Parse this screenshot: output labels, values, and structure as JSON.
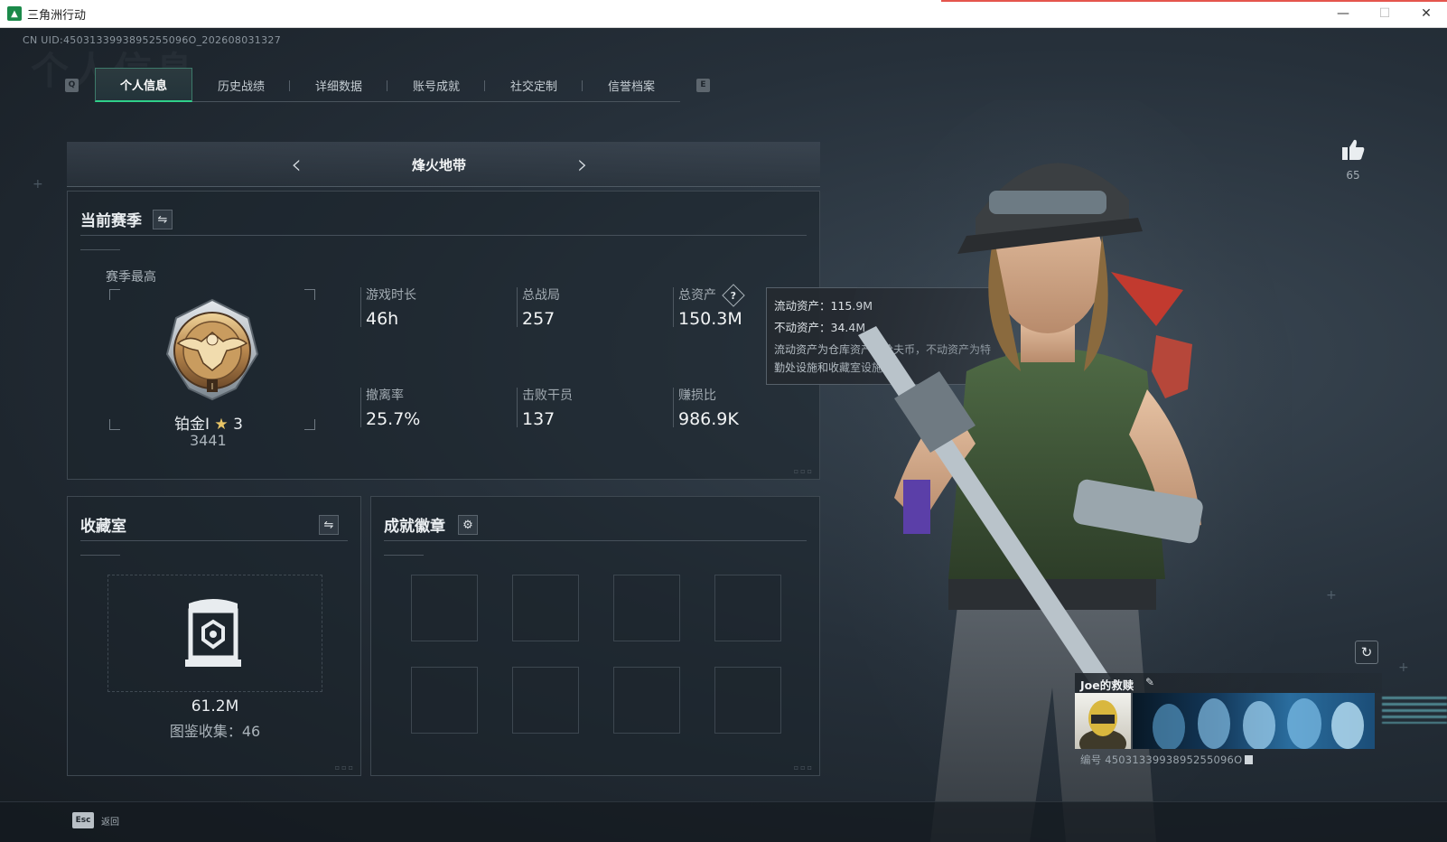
{
  "window": {
    "title": "三角洲行动",
    "minimize": "—",
    "maximize": "☐",
    "close": "✕"
  },
  "header": {
    "uid_text": "CN UID:4503133993895255096O_202608031327",
    "watermark": "个人信息"
  },
  "tabs": {
    "prev_key": "Q",
    "next_key": "E",
    "items": [
      {
        "label": "个人信息",
        "active": true
      },
      {
        "label": "历史战绩",
        "active": false
      },
      {
        "label": "详细数据",
        "active": false
      },
      {
        "label": "账号成就",
        "active": false
      },
      {
        "label": "社交定制",
        "active": false
      },
      {
        "label": "信誉档案",
        "active": false
      }
    ]
  },
  "mode": {
    "title": "烽火地带",
    "prev_arrow": "‹",
    "next_arrow": "›"
  },
  "season": {
    "title": "当前赛季",
    "switch_icon": "⇋",
    "best_label": "赛季最高",
    "rank_name": "铂金I",
    "rank_star_icon": "★",
    "rank_stars": "3",
    "rank_score": "3441",
    "stats": [
      {
        "label": "游戏时长",
        "value": "46h"
      },
      {
        "label": "总战局",
        "value": "257"
      },
      {
        "label": "总资产",
        "value": "150.3M",
        "help": "?"
      },
      {
        "label": "撤离率",
        "value": "25.7%"
      },
      {
        "label": "击败干员",
        "value": "137"
      },
      {
        "label": "赚损比",
        "value": "986.9K"
      }
    ],
    "corner_dots": "▫▫▫"
  },
  "tooltip": {
    "liquid": "流动资产：115.9M",
    "fixed": "不动资产：34.4M",
    "note": "流动资产为仓库资产和哈夫币，不动资产为特勤处设施和收藏室设施"
  },
  "collection": {
    "title": "收藏室",
    "switch_icon": "⇋",
    "value": "61.2M",
    "count_text": "图鉴收集：46",
    "corner_dots": "▫▫▫"
  },
  "achievements": {
    "title": "成就徽章",
    "gear_icon": "⚙",
    "corner_dots": "▫▫▫"
  },
  "profile": {
    "likes": "65",
    "like_icon": "thumbs-up-icon",
    "refresh_icon": "↻",
    "card_name": "Joe的救赎",
    "edit_icon": "✎",
    "card_id": "编号 4503133993895255096O"
  },
  "footer": {
    "esc_key": "Esc",
    "back_label": "返回"
  },
  "colors": {
    "accent": "#2fd08a",
    "background": "#26303a",
    "panel": "#1c242c",
    "text": "#cfd6dc"
  }
}
